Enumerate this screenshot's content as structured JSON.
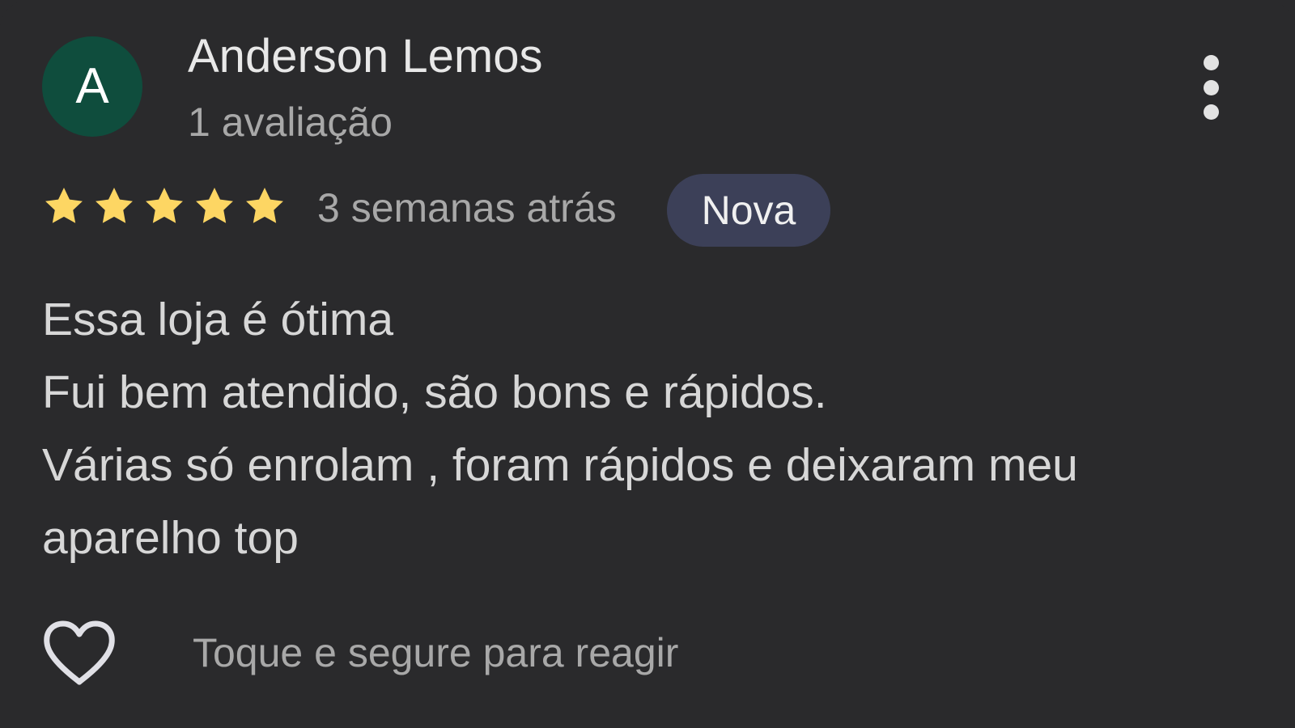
{
  "reviewer": {
    "initial": "A",
    "name": "Anderson Lemos",
    "review_count": "1 avaliação",
    "avatar_color": "#0f4d3d"
  },
  "menu": {
    "icon": "more-vert-icon"
  },
  "rating": {
    "stars": 5,
    "max_stars": 5,
    "star_color": "#fdd663",
    "time": "3 semanas atrás",
    "badge": "Nova"
  },
  "review": {
    "lines": [
      "Essa loja é ótima",
      "Fui bem atendido, são bons e rápidos.",
      "Várias só enrolam , foram rápidos e deixaram meu",
      "aparelho top"
    ]
  },
  "reaction": {
    "icon": "heart-outline-icon",
    "hint": "Toque e segure para reagir"
  }
}
